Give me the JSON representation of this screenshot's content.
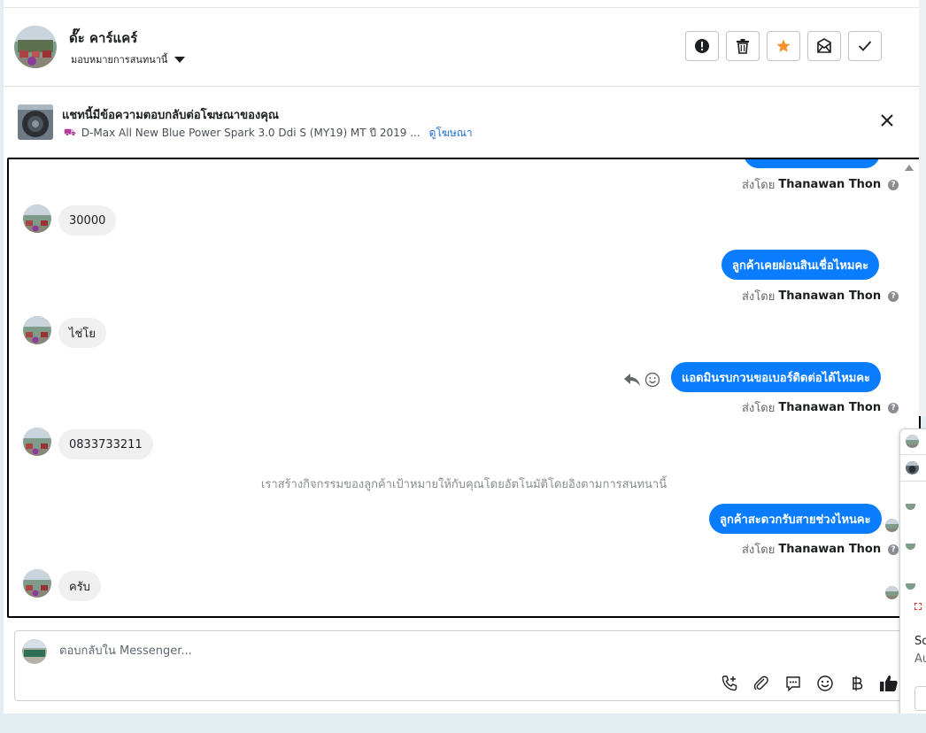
{
  "header": {
    "contact_name": "ดั๊ะ คาร์แคร์",
    "assign_label": "มอบหมายการสนทนานี้",
    "actions": [
      {
        "name": "spam",
        "icon": "exclamation-circle-icon"
      },
      {
        "name": "delete",
        "icon": "trash-icon"
      },
      {
        "name": "star",
        "icon": "star-icon",
        "color": "#f5922f"
      },
      {
        "name": "mark-unread",
        "icon": "envelope-icon"
      },
      {
        "name": "done",
        "icon": "check-icon"
      }
    ]
  },
  "ad": {
    "title": "แชทนี้มีข้อความตอบกลับต่อโฆษณาของคุณ",
    "product": "D-Max All New Blue Power Spark 3.0 Ddi S (MY19) MT ปี 2019 ...",
    "view_link": "ดูโฆษณา"
  },
  "messages": {
    "sent_by_prefix": "ส่งโดย",
    "sender_name": "Thanawan Thon",
    "m1": "30000",
    "m2": "ลูกค้าเคยผ่อนสินเชื่อไหมคะ",
    "m3": "ไช่โย",
    "m4": "แอดมินรบกวนขอเบอร์ติดต่อได้ไหมคะ",
    "m5": "0833733211",
    "system_note": "เราสร้างกิจกรรมของลูกค้าเป้าหมายให้กับคุณโดยอัตโนมัติโดยอิงตามการสนทนานี้",
    "m6": "ลูกค้าสะดวกรับสายช่วงไหนคะ",
    "m7": "ครับ"
  },
  "composer": {
    "placeholder": "ตอบกลับใน Messenger...",
    "tools": [
      "add-call-icon",
      "paperclip-icon",
      "saved-reply-icon",
      "emoji-icon",
      "baht-icon",
      "thumbs-up-icon"
    ]
  },
  "popup": {
    "frag1": "Sc",
    "frag2": "Au"
  },
  "colors": {
    "outgoing_bubble": "#0a7cff",
    "incoming_bubble": "#f0f0f0",
    "link": "#1c6ed3"
  }
}
